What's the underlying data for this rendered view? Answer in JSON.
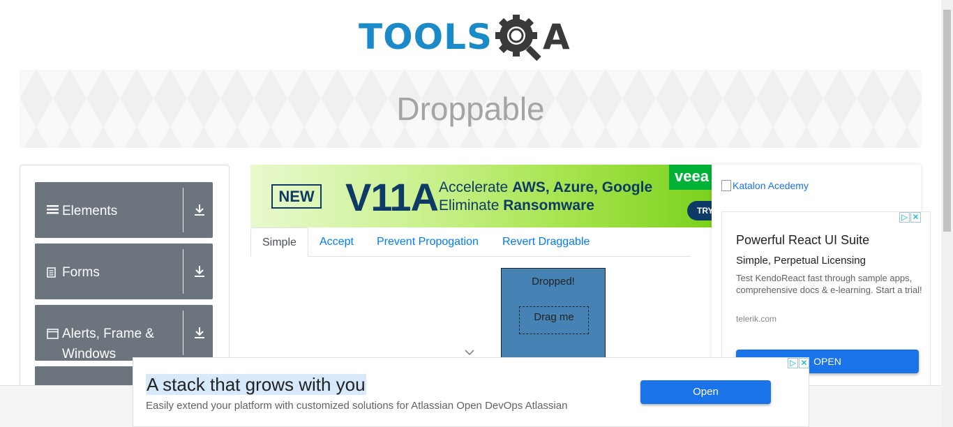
{
  "brand": {
    "tools": "TOOLS",
    "qa": "A"
  },
  "banner": {
    "title": "Droppable"
  },
  "sidebar": {
    "groups": [
      {
        "label": "Elements",
        "icon": "hamburger-icon"
      },
      {
        "label": "Forms",
        "icon": "document-icon"
      },
      {
        "label": "Alerts, Frame & Windows",
        "icon": "window-icon"
      },
      {
        "label": "",
        "icon": ""
      }
    ]
  },
  "ad_top": {
    "badge": "NEW",
    "headline": "V11A",
    "line1_prefix": "Accelerate ",
    "line1_bold": "AWS, Azure, Google",
    "line2_prefix": "Eliminate ",
    "line2_bold": "Ransomware",
    "brand": "veea",
    "cta": "TRY"
  },
  "tabs": [
    {
      "label": "Simple",
      "active": true
    },
    {
      "label": "Accept",
      "active": false
    },
    {
      "label": "Prevent Propogation",
      "active": false
    },
    {
      "label": "Revert Draggable",
      "active": false
    }
  ],
  "droppable": {
    "text": "Dropped!",
    "drag_text": "Drag me"
  },
  "right_ad": {
    "image_alt": "Katalon Acedemy",
    "headline": "Powerful React UI Suite",
    "subhead": "Simple, Perpetual Licensing",
    "body": "Test KendoReact fast through sample apps, comprehensive docs & e-learning. Start a trial!",
    "domain": "telerik.com",
    "cta": "OPEN"
  },
  "bottom_ad": {
    "title": "A stack that grows with you",
    "desc": "Easily extend your platform with customized solutions for Atlassian Open DevOps Atlassian",
    "cta": "Open"
  },
  "colors": {
    "accent": "#007bff",
    "sidebar": "#6c757d",
    "droppable": "#4682b4",
    "ad_button": "#1a73e8"
  }
}
